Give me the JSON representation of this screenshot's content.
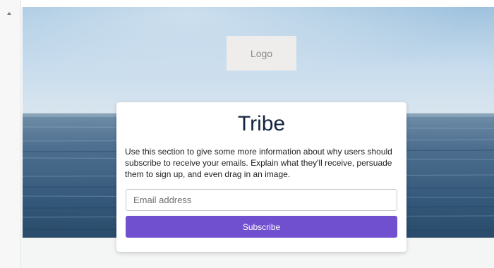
{
  "hero": {
    "logo_label": "Logo"
  },
  "card": {
    "title": "Tribe",
    "description": "Use this section to give some more information about why users should subscribe to receive your emails. Explain what they'll receive, persuade them to sign up, and even drag in an image.",
    "email_placeholder": "Email address",
    "subscribe_label": "Subscribe"
  },
  "colors": {
    "button": "#7150d0",
    "title": "#13233f",
    "sky": "#bfd7e8",
    "sea": "#2f4e6e"
  },
  "icons": {
    "scroll_up": "scroll-up-arrow-icon"
  }
}
